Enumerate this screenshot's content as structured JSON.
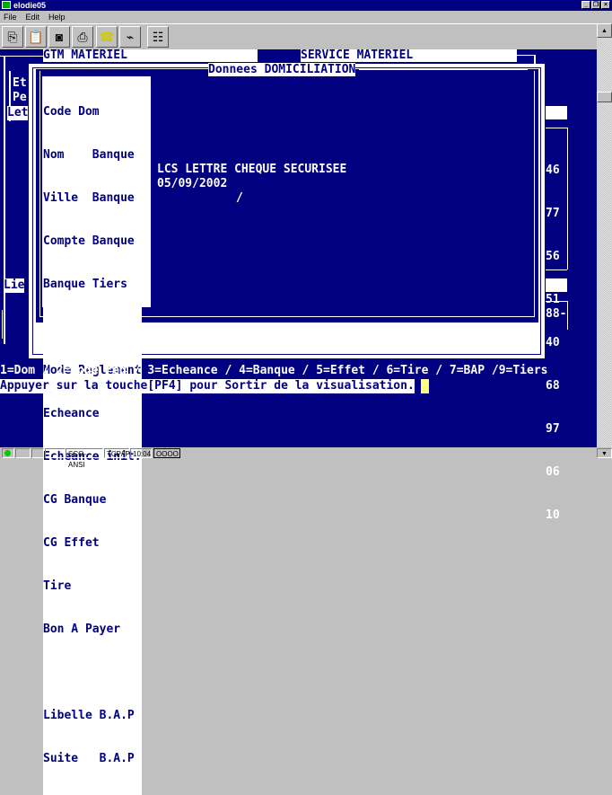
{
  "window": {
    "title": "elodie05",
    "menu": [
      "File",
      "Edit",
      "Help"
    ]
  },
  "toolbar": {
    "buttons": [
      "copy-icon",
      "paste-icon",
      "camera-icon",
      "print-icon",
      "phone-icon",
      "hangup-icon",
      "settings-icon"
    ]
  },
  "terminal": {
    "header_left": "GTM MATERIEL",
    "header_right": "SERVICE MATERIEL",
    "dialog_title": "Donnees DOMICILIATION",
    "bg_left": [
      "Et",
      "Pe",
      "Let",
      "Lie"
    ],
    "bg_right_numbers": [
      "46",
      "77",
      "56",
      "51",
      "40",
      "68",
      "97",
      "06",
      "10"
    ],
    "bg_right_tail": "88-",
    "labels": [
      "Code Dom",
      "Nom    Banque",
      "Ville  Banque",
      "Compte Banque",
      "Banque Tiers",
      "",
      "Mode Reglement",
      "Echeance",
      "Echeance init.",
      "CG Banque",
      "CG Effet",
      "Tire",
      "Bon A Payer",
      "",
      "Libelle B.A.P",
      "Suite   B.A.P"
    ],
    "values": {
      "mode_reglement": "LCS LETTRE CHEQUE SECURISEE",
      "echeance": "05/09/2002",
      "echeance_init": "/"
    },
    "function_keys": "1=Dom / 2=Mode reg / 3=Echeance / 4=Banque / 5=Effet / 6=Tire / 7=BAP /9=Tiers",
    "prompt": "Appuyer sur la touche[PF4] pour Sortir de la visualisation."
  },
  "status": {
    "cells": [
      "SCO-ANSI",
      "TCP/IP",
      "10:04",
      "OOOO"
    ]
  },
  "colors": {
    "terminal_bg": "#000080",
    "cursor": "#ffff80"
  }
}
